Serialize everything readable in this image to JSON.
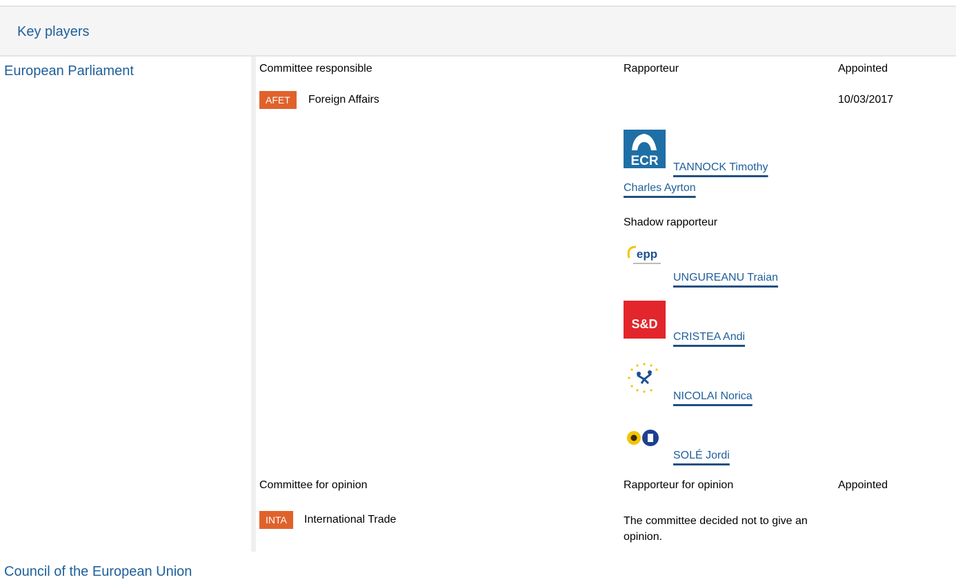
{
  "header": {
    "title": "Key players"
  },
  "sections": {
    "ep": "European Parliament",
    "council": "Council of the European Union"
  },
  "responsible": {
    "col_committee": "Committee responsible",
    "col_rapporteur": "Rapporteur",
    "col_appointed": "Appointed",
    "committee_code": "AFET",
    "committee_name": "Foreign Affairs",
    "appointed_date": "10/03/2017",
    "rapporteur": {
      "group": "ECR",
      "name_line1": "TANNOCK Timothy",
      "name_line2": "Charles Ayrton"
    },
    "shadow_label": "Shadow rapporteur",
    "shadows": [
      {
        "group": "EPP",
        "name": "UNGUREANU Traian"
      },
      {
        "group": "S&D",
        "name": "CRISTEA Andi"
      },
      {
        "group": "ALDE",
        "name": "NICOLAI Norica"
      },
      {
        "group": "Greens/EFA",
        "name": "SOLÉ Jordi"
      }
    ]
  },
  "opinion": {
    "col_committee": "Committee for opinion",
    "col_rapporteur": "Rapporteur for opinion",
    "col_appointed": "Appointed",
    "committee_code": "INTA",
    "committee_name": "International Trade",
    "note": "The committee decided not to give an opinion."
  },
  "colors": {
    "link": "#1f5f9a",
    "badge": "#e0622b",
    "ecr": "#1e6fa6",
    "sd": "#e2262b"
  }
}
